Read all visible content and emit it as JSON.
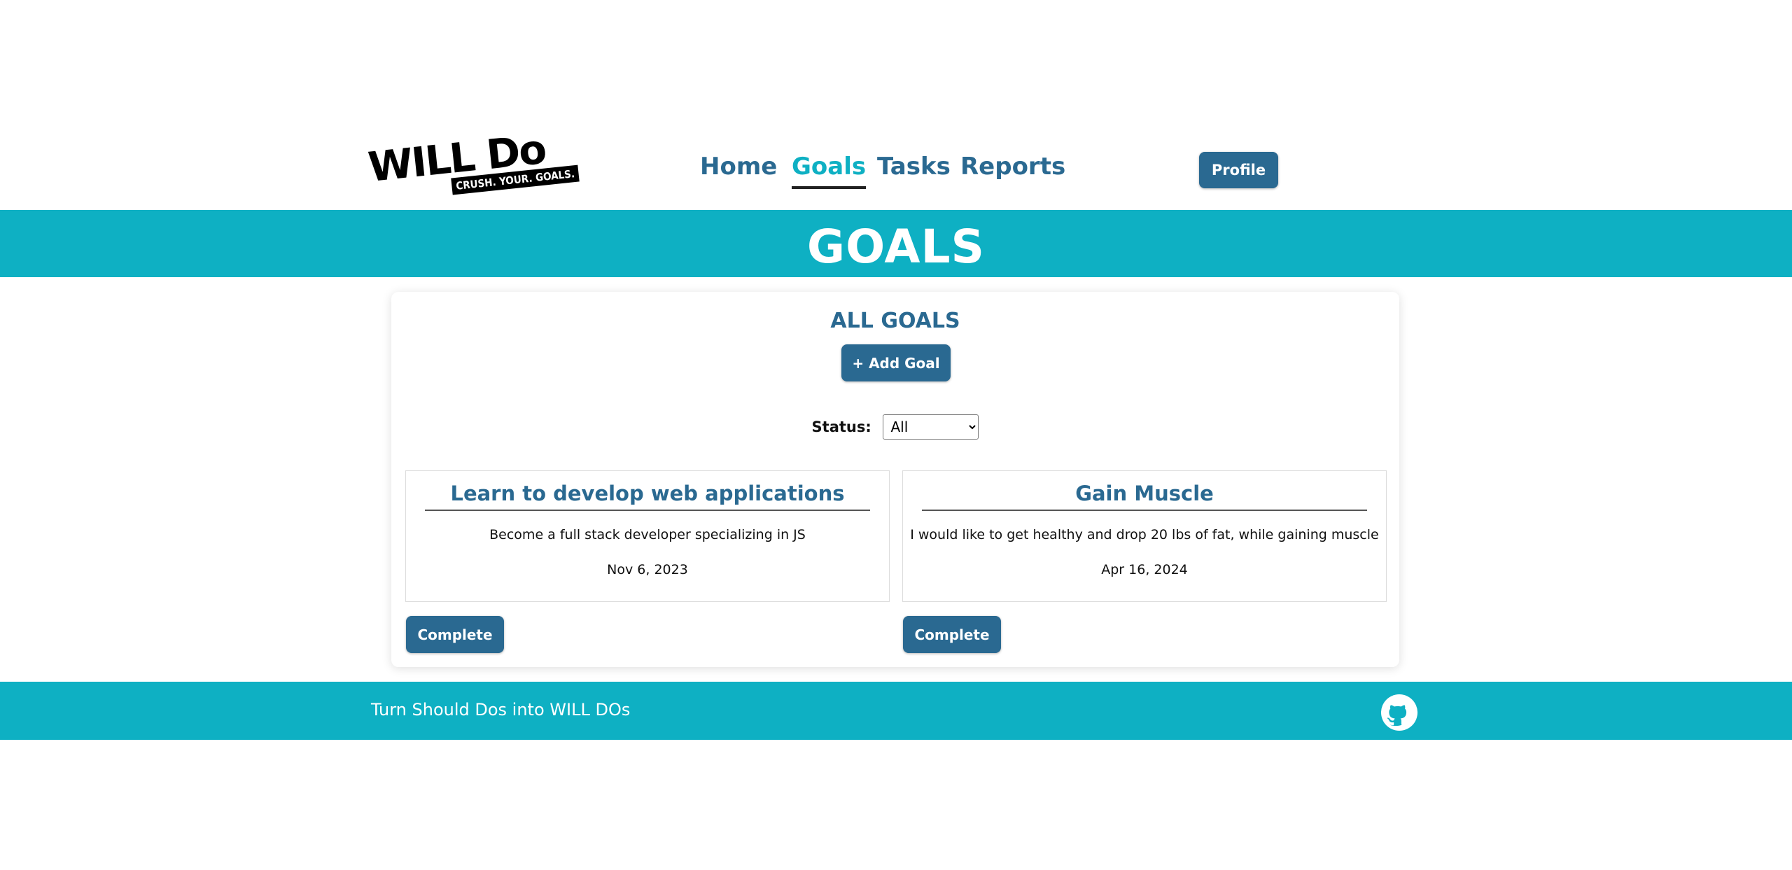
{
  "logo": {
    "main": "WILL Do",
    "tagline": "CRUSH. YOUR. GOALS."
  },
  "nav": {
    "items": [
      {
        "label": "Home",
        "active": false
      },
      {
        "label": "Goals",
        "active": true
      },
      {
        "label": "Tasks",
        "active": false
      },
      {
        "label": "Reports",
        "active": false
      }
    ],
    "profile_label": "Profile"
  },
  "banner": {
    "title": "GOALS"
  },
  "goals_section": {
    "title": "ALL GOALS",
    "add_label": "+ Add Goal",
    "status_label": "Status:",
    "status_selected": "All"
  },
  "goals": [
    {
      "title": "Learn to develop web applications",
      "description": "Become a full stack developer specializing in JS",
      "date": "Nov 6, 2023",
      "action_label": "Complete"
    },
    {
      "title": "Gain Muscle",
      "description": "I would like to get healthy and drop 20 lbs of fat, while gaining muscle",
      "date": "Apr 16, 2024",
      "action_label": "Complete"
    }
  ],
  "footer": {
    "text": "Turn Should Dos into WILL DOs",
    "icon": "github-icon"
  },
  "colors": {
    "primary": "#2a6991",
    "accent": "#0eb0c3",
    "background": "#ffffff"
  }
}
